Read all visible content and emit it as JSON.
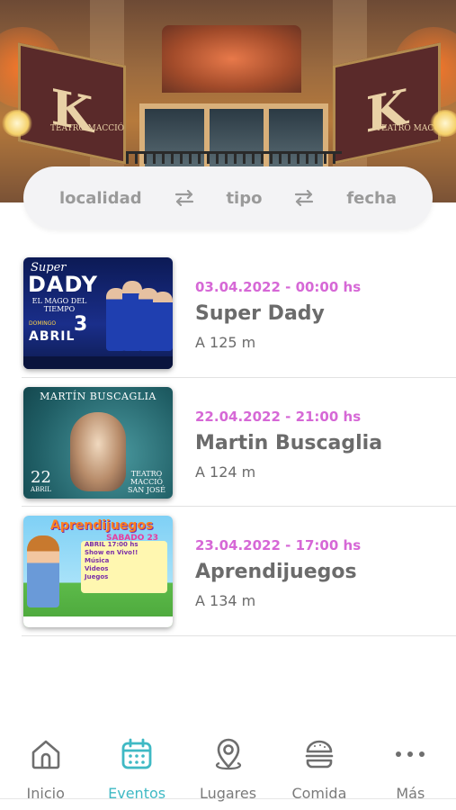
{
  "filters": {
    "localidad": "localidad",
    "tipo": "tipo",
    "fecha": "fecha"
  },
  "events": [
    {
      "date": "03.04.2022 - 00:00 hs",
      "title": "Super Dady",
      "distance": "A 125 m",
      "poster": {
        "line1": "Super",
        "line2": "DADY",
        "line3": "EL MAGO DEL TIEMPO",
        "day_label": "DOMINGO",
        "day_number": "3",
        "month": "ABRIL"
      }
    },
    {
      "date": "22.04.2022 - 21:00 hs",
      "title": "Martin Buscaglia",
      "distance": "A 124 m",
      "poster": {
        "name": "MARTÍN BUSCAGLIA",
        "day_number": "22",
        "month": "ABRIL",
        "venue": "TEATRO MACCIÓ SAN JOSÉ"
      }
    },
    {
      "date": "23.04.2022 - 17:00 hs",
      "title": "Aprendijuegos",
      "distance": "A 134 m",
      "poster": {
        "name": "Aprendijuegos",
        "day": "SABADO 23",
        "line1": "ABRIL 17:00 hs",
        "line2": "Show en Vivo!!",
        "line3": "Música",
        "line4": "Videos",
        "line5": "Juegos"
      }
    }
  ],
  "nav": {
    "inicio": "Inicio",
    "eventos": "Eventos",
    "lugares": "Lugares",
    "comida": "Comida",
    "mas": "Más",
    "active": "eventos"
  },
  "hero": {
    "banner_left": "TEATRO MACCIÓ",
    "banner_right": "TEATRO MACCIÓ"
  },
  "colors": {
    "accent": "#3fb9c4",
    "date": "#d668d6",
    "text": "#6b6b6b",
    "filter_bg": "#f3f3f5"
  }
}
